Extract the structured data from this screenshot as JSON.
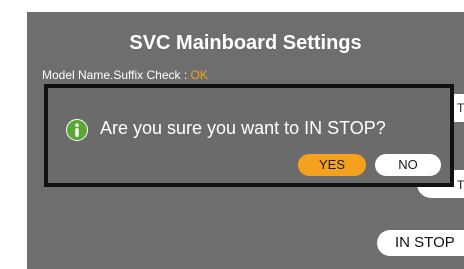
{
  "screen": {
    "title": "SVC Mainboard Settings",
    "model_check_label": "Model Name.Suffix Check : ",
    "model_check_value": "OK",
    "side_label_1": "T",
    "side_label_2": "T",
    "instop_button": "IN STOP"
  },
  "dialog": {
    "icon": "info-icon",
    "question": "Are you sure you want to IN STOP?",
    "yes_label": "YES",
    "no_label": "NO"
  },
  "colors": {
    "screen_bg": "#6e6e6e",
    "accent": "#f4a21d",
    "icon_green": "#5aa832"
  }
}
